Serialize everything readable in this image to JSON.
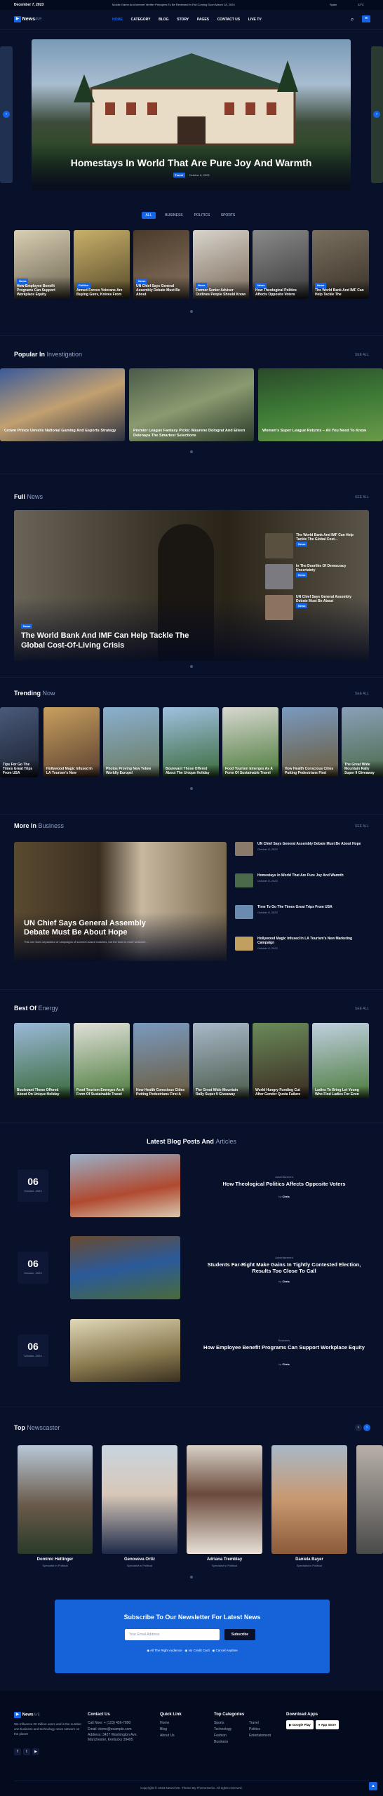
{
  "topbar": {
    "date": "December 7, 2023",
    "ticker": "Mobile Game And Internet Verifier Principles To Be Reviewed In Fall Coming Soon March 18, 2024",
    "location": "Spain",
    "temp": "22°C"
  },
  "header": {
    "logo": "News",
    "logo_suffix": "AVE",
    "nav": [
      "HOME",
      "CATEGORY",
      "BLOG",
      "STORY",
      "PAGES",
      "CONTACT US",
      "LIVE TV"
    ]
  },
  "hero": {
    "title": "Homestays In World That Are Pure Joy And Warmth",
    "category": "Travel",
    "date": "October 8, 2023"
  },
  "tabs": [
    "ALL",
    "BUSINESS",
    "POLITICS",
    "SPORTS"
  ],
  "cards_row1": [
    {
      "title": "How Employee Benefit Programs Can Support Workplace Equity",
      "badge": "News"
    },
    {
      "title": "Armed Forces Veterans Are Buying Guns, Knives From",
      "badge": "Politics"
    },
    {
      "title": "UN Chief Says General Assembly Debate Must Be About",
      "badge": "News"
    },
    {
      "title": "Former Senior Adviser Outlines People Should Know",
      "badge": "News"
    },
    {
      "title": "How Theological Politics Affects Opposite Voters",
      "badge": "News"
    },
    {
      "title": "The World Bank And IMF Can Help Tackle The",
      "badge": "News"
    }
  ],
  "popular": {
    "title": "Popular In",
    "title_suffix": "Investigation",
    "see_all": "SEE ALL",
    "items": [
      {
        "title": "Crown Prince Unveils National Gaming And Esports Strategy"
      },
      {
        "title": "Premier League Fantasy Picks: Maurene Dolograt And Eileen Delenaya The Smartest Selections"
      },
      {
        "title": "Women's Super League Returns – All You Need To Know"
      }
    ]
  },
  "full_news": {
    "title": "Full",
    "title_suffix": "News",
    "see_all": "SEE ALL",
    "headline": "The World Bank And IMF Can Help Tackle The Global Cost-Of-Living Crisis",
    "badge": "News",
    "side": [
      {
        "title": "The World Bank And IMF Can Help Tackle The Global Cost...",
        "badge": "News"
      },
      {
        "title": "In The Doorlike Of Democracy Uncertainty",
        "badge": "News"
      },
      {
        "title": "UN Chief Says General Assembly Debate Must Be About",
        "badge": "News"
      }
    ]
  },
  "trending": {
    "title": "Trending",
    "title_suffix": "Now",
    "see_all": "SEE ALL",
    "items": [
      {
        "title": "Tips For Go The Times Great Trips From USA"
      },
      {
        "title": "Hollywood Magic Infused In LA Tourism's New"
      },
      {
        "title": "Photos Proving New Yelow Worldly Europe!"
      },
      {
        "title": "Boulevant Those Offered About The Unique Holiday"
      },
      {
        "title": "Food Tourism Emerges As A Form Of Sustainable Travel"
      },
      {
        "title": "How Health Conscious Cities Putting Pedestrians First"
      },
      {
        "title": "The Great Wide Mountain Rally Super 9 Giveaway"
      }
    ]
  },
  "business": {
    "title": "More In",
    "title_suffix": "Business",
    "see_all": "SEE ALL",
    "headline": "UN Chief Says General Assembly Debate Must Be About Hope",
    "excerpt": "This one does separation of campaigns of summer-based matches, but the town is more welcome...",
    "list": [
      {
        "title": "UN Chief Says General Assembly Debate Must Be About Hope",
        "date": "October 8, 2023"
      },
      {
        "title": "Homestays In World That Are Pure Joy And Warmth",
        "date": "October 8, 2023"
      },
      {
        "title": "Time To Go The Times Great Trips From USA",
        "date": "October 8, 2023"
      },
      {
        "title": "Hollywood Magic Infused In LA Tourism's New Marketing Campaign",
        "date": "October 8, 2023"
      }
    ]
  },
  "energy": {
    "title": "Best Of",
    "title_suffix": "Energy",
    "see_all": "SEE ALL",
    "items": [
      {
        "title": "Boulevant Those Offered About On Unique Holiday"
      },
      {
        "title": "Food Tourism Emerges As A Form Of Sustainable Travel"
      },
      {
        "title": "How Health Conscious Cities Putting Pedestrians First A"
      },
      {
        "title": "The Great Wide Mountain Rally Super 9 Giveaway"
      },
      {
        "title": "World Hungry Funding Cut After Gender Quota Failure"
      },
      {
        "title": "Ladies To Bring Let Young Who Find Ladies For Even"
      }
    ]
  },
  "blog": {
    "title": "Latest Blog Posts And",
    "title_suffix": "Articles",
    "posts": [
      {
        "day": "06",
        "month": "October, 2023",
        "category": "Advertisement",
        "title": "How Theological Politics Affects Opposite Voters",
        "author": "Chris"
      },
      {
        "day": "06",
        "month": "October, 2023",
        "category": "Advertisement",
        "title": "Students Far-Right Make Gains In Tightly Contested Election, Results Too Close To Call",
        "author": "Chris"
      },
      {
        "day": "06",
        "month": "October, 2023",
        "category": "Business",
        "title": "How Employee Benefit Programs Can Support Workplace Equity",
        "author": "Chris"
      }
    ]
  },
  "newscaster": {
    "title": "Top",
    "title_suffix": "Newscaster",
    "people": [
      {
        "name": "Dominic Hettinger",
        "role": "Specialist in Political"
      },
      {
        "name": "Genoveva Ortiz",
        "role": "Specialist in Political"
      },
      {
        "name": "Adriana Tremblay",
        "role": "Specialist in Political"
      },
      {
        "name": "Daniela Bayer",
        "role": "Specialist in Political"
      }
    ]
  },
  "newsletter": {
    "title": "Subscribe To Our Newsletter For Latest News",
    "placeholder": "Your Email Address",
    "button": "Subscribe",
    "options": [
      "All The Right Audience",
      "No Credit Card",
      "Cancel Anytime"
    ]
  },
  "footer": {
    "about": "We Influence 20 million users and is the number one business and technology news network on the planet",
    "contact_title": "Contact Us",
    "contact": [
      "Call Now: + (123) 456-7890",
      "Email: demo@example.com",
      "Address: 3427 Washington Ave. Manchester, Kentucky 39495"
    ],
    "quick_title": "Quick Link",
    "quick": [
      "Home",
      "Blog",
      "About Us",
      "Contact"
    ],
    "top_title": "Top Categories",
    "top_col1": [
      "Sports",
      "Technology",
      "Fashion",
      "Business"
    ],
    "top_col2": [
      "Travel",
      "Politics",
      "Entertainment"
    ],
    "download_title": "Download Apps",
    "google": "Google Play",
    "apple": "App Store",
    "copyright": "Copyright © 2023 NewsAVE. Theme By ThemeGenix. All rights reserved."
  }
}
